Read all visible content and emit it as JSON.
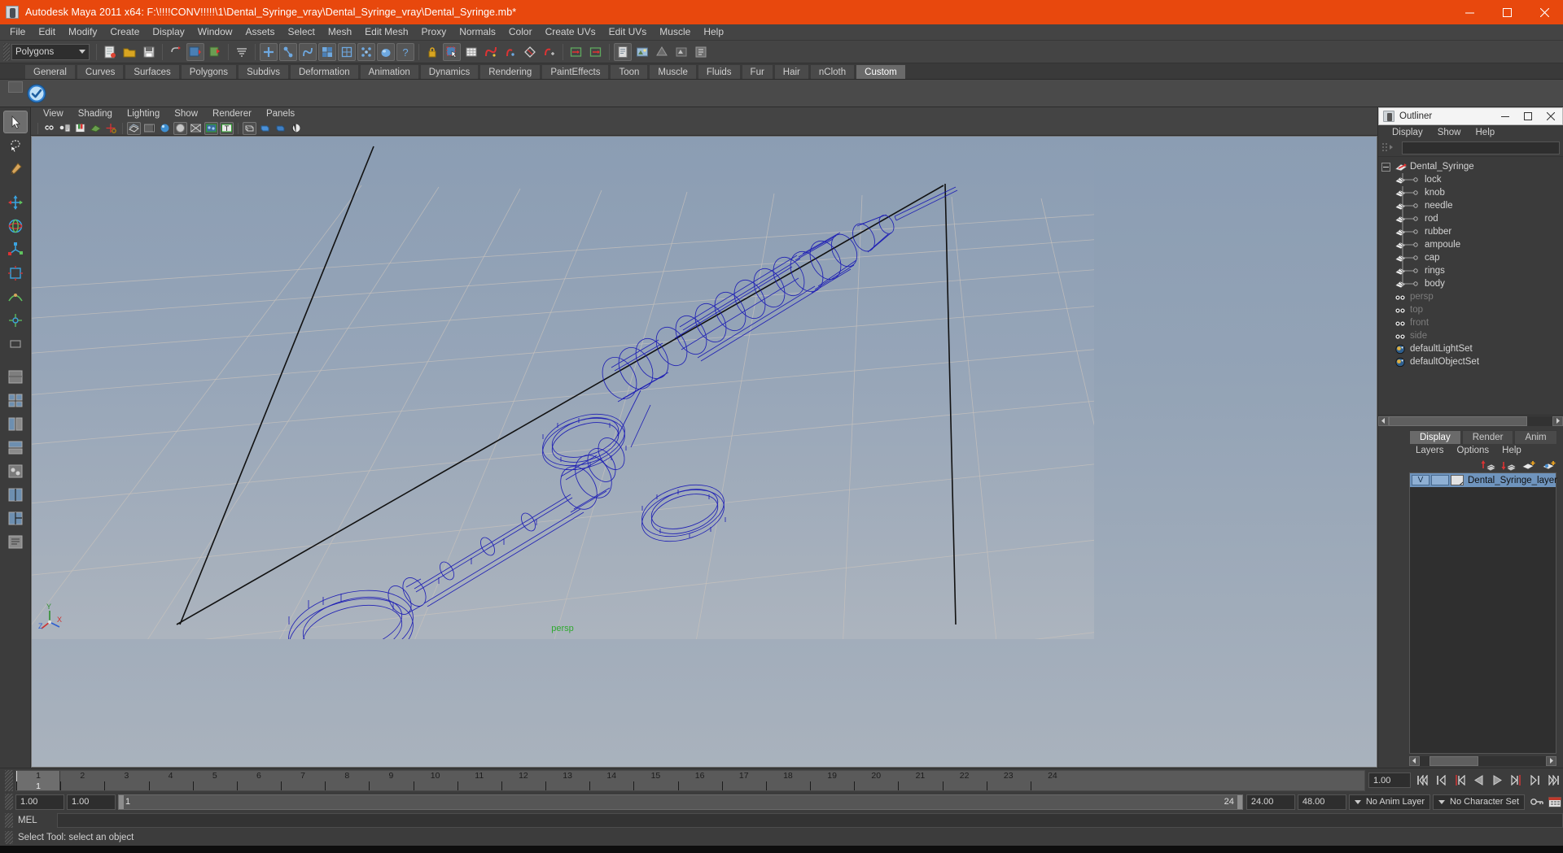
{
  "window": {
    "title": "Autodesk Maya 2011 x64: F:\\!!!!CONV!!!!!\\1\\Dental_Syringe_vray\\Dental_Syringe_vray\\Dental_Syringe.mb*",
    "app_icon": "maya-icon",
    "titlebar_color": "#e8480d",
    "minimize_label": "Minimize",
    "maximize_label": "Maximize",
    "close_label": "Close"
  },
  "menubar": {
    "items": [
      "File",
      "Edit",
      "Modify",
      "Create",
      "Display",
      "Window",
      "Assets",
      "Select",
      "Mesh",
      "Edit Mesh",
      "Proxy",
      "Normals",
      "Color",
      "Create UVs",
      "Edit UVs",
      "Muscle",
      "Help"
    ]
  },
  "toolbar": {
    "mode_select": "Polygons",
    "icons": [
      "new-scene-icon",
      "open-scene-icon",
      "save-scene-icon",
      "undo-icon",
      "redo-icon",
      "redo-alt-icon",
      "select-hierarchy-icon",
      "select-by-object-icon",
      "select-by-component-icon",
      "select-curve-icon",
      "select-face-icon",
      "select-uv-icon",
      "select-vertex-icon",
      "select-point-icon",
      "select-question-icon",
      "lock-icon",
      "snap-cursor-icon",
      "snap-grid-icon",
      "snap-curve-icon",
      "snap-point-icon",
      "snap-plane-icon",
      "snap-view-icon",
      "input-connection-icon",
      "output-connection-icon",
      "attribute-editor-icon",
      "render-view-icon",
      "render-icon",
      "ipr-render-icon",
      "render-settings-icon"
    ]
  },
  "shelf": {
    "tabs": [
      "General",
      "Curves",
      "Surfaces",
      "Polygons",
      "Subdivs",
      "Deformation",
      "Animation",
      "Dynamics",
      "Rendering",
      "PaintEffects",
      "Toon",
      "Muscle",
      "Fluids",
      "Fur",
      "Hair",
      "nCloth",
      "Custom"
    ],
    "active_tab": "Custom",
    "buttons": [
      "vray-checkmark-icon"
    ]
  },
  "toolbox": {
    "items": [
      {
        "name": "select-tool",
        "label": "Select Tool",
        "active": true
      },
      {
        "name": "lasso-tool",
        "label": "Lasso Tool",
        "active": false
      },
      {
        "name": "paint-select-tool",
        "label": "Paint Selection Tool",
        "active": false
      },
      {
        "name": "move-tool",
        "label": "Move Tool",
        "active": false
      },
      {
        "name": "rotate-tool",
        "label": "Rotate Tool",
        "active": false
      },
      {
        "name": "scale-tool",
        "label": "Scale Tool",
        "active": false
      },
      {
        "name": "universal-manipulator-tool",
        "label": "Universal Manipulator",
        "active": false
      },
      {
        "name": "soft-modification-tool",
        "label": "Soft Modification Tool",
        "active": false
      },
      {
        "name": "show-manipulator-tool",
        "label": "Show Manipulator Tool",
        "active": false
      },
      {
        "name": "last-tool",
        "label": "Last Tool Used",
        "active": false
      }
    ],
    "layout_items": [
      "single-perspective-layout",
      "four-view-layout",
      "persp-outliner-layout",
      "persp-graph-layout",
      "persp-hypershade-layout",
      "two-pane-layout",
      "three-pane-layout",
      "outliner-layout"
    ]
  },
  "viewport": {
    "menus": [
      "View",
      "Shading",
      "Lighting",
      "Show",
      "Renderer",
      "Panels"
    ],
    "toolbar_icons": [
      "select-camera-icon",
      "camera-attributes-icon",
      "bookmark-icon",
      "image-plane-icon",
      "two-dimensional-pan-zoom-icon",
      "wireframe-icon",
      "smooth-shade-icon",
      "smooth-shade-all-icon",
      "flat-shade-icon",
      "wireframe-on-shaded-icon",
      "texture-icon",
      "lighting-icon",
      "shadows-icon",
      "xray-icon",
      "xray-joints-icon",
      "hardware-texturing-icon",
      "exposure-icon",
      "gamma-icon",
      "grid-icon"
    ],
    "camera_label": "persp",
    "camera_label_color": "#2faa2f",
    "background_top": "#8b9db3",
    "background_bottom": "#a9b2bd",
    "wireframe_color": "#1515a8",
    "axis_labels": [
      "X",
      "Y",
      "Z"
    ],
    "model_name": "Dental_Syringe"
  },
  "outliner": {
    "panel_title": "Outliner",
    "menus": [
      "Display",
      "Show",
      "Help"
    ],
    "search_value": "",
    "search_placeholder": "",
    "items": [
      {
        "label": "Dental_Syringe",
        "icon": "transform-icon",
        "indent": 0,
        "expandable": true,
        "dim": false
      },
      {
        "label": "lock",
        "icon": "mesh-icon",
        "indent": 1,
        "expandable": false,
        "dim": false
      },
      {
        "label": "knob",
        "icon": "mesh-icon",
        "indent": 1,
        "expandable": false,
        "dim": false
      },
      {
        "label": "needle",
        "icon": "mesh-icon",
        "indent": 1,
        "expandable": false,
        "dim": false
      },
      {
        "label": "rod",
        "icon": "mesh-icon",
        "indent": 1,
        "expandable": false,
        "dim": false
      },
      {
        "label": "rubber",
        "icon": "mesh-icon",
        "indent": 1,
        "expandable": false,
        "dim": false
      },
      {
        "label": "ampoule",
        "icon": "mesh-icon",
        "indent": 1,
        "expandable": false,
        "dim": false
      },
      {
        "label": "cap",
        "icon": "mesh-icon",
        "indent": 1,
        "expandable": false,
        "dim": false
      },
      {
        "label": "rings",
        "icon": "mesh-icon",
        "indent": 1,
        "expandable": false,
        "dim": false
      },
      {
        "label": "body",
        "icon": "mesh-icon",
        "indent": 1,
        "expandable": false,
        "dim": false
      },
      {
        "label": "persp",
        "icon": "camera-icon",
        "indent": 0,
        "expandable": false,
        "dim": true
      },
      {
        "label": "top",
        "icon": "camera-icon",
        "indent": 0,
        "expandable": false,
        "dim": true
      },
      {
        "label": "front",
        "icon": "camera-icon",
        "indent": 0,
        "expandable": false,
        "dim": true
      },
      {
        "label": "side",
        "icon": "camera-icon",
        "indent": 0,
        "expandable": false,
        "dim": true
      },
      {
        "label": "defaultLightSet",
        "icon": "set-icon",
        "indent": 0,
        "expandable": false,
        "dim": false
      },
      {
        "label": "defaultObjectSet",
        "icon": "set-icon",
        "indent": 0,
        "expandable": false,
        "dim": false
      }
    ]
  },
  "layer_editor": {
    "tabs": [
      "Display",
      "Render",
      "Anim"
    ],
    "active_tab": "Display",
    "menus": [
      "Layers",
      "Options",
      "Help"
    ],
    "tool_icons": [
      "new-layer-up-icon",
      "new-layer-down-icon",
      "new-layer-icon",
      "new-layer-selected-icon"
    ],
    "layers": [
      {
        "visibility": "V",
        "type": "",
        "name": "Dental_Syringe_layer",
        "selected": true
      }
    ],
    "selected_color": "#6f94bd"
  },
  "timeslider": {
    "ticks": [
      "1",
      "2",
      "3",
      "4",
      "5",
      "6",
      "7",
      "8",
      "9",
      "10",
      "11",
      "12",
      "13",
      "14",
      "15",
      "16",
      "17",
      "18",
      "19",
      "20",
      "21",
      "22",
      "23",
      "24"
    ],
    "current_frame": "1",
    "current_frame_field": "1.00",
    "playback_buttons": [
      "go-to-start-icon",
      "step-back-key-icon",
      "step-back-frame-icon",
      "play-backwards-icon",
      "play-forwards-icon",
      "step-forward-frame-icon",
      "step-forward-key-icon",
      "go-to-end-icon"
    ]
  },
  "rangebar": {
    "range_start": "1.00",
    "anim_start": "1.00",
    "playback_start": "1",
    "playback_end": "24",
    "anim_end": "24.00",
    "range_end": "48.00",
    "anim_layer": "No Anim Layer",
    "character_set": "No Character Set",
    "icons": [
      "auto-key-icon",
      "animation-preferences-icon"
    ]
  },
  "mel": {
    "label": "MEL",
    "value": "",
    "placeholder": ""
  },
  "status": {
    "message": "Select Tool: select an object"
  }
}
